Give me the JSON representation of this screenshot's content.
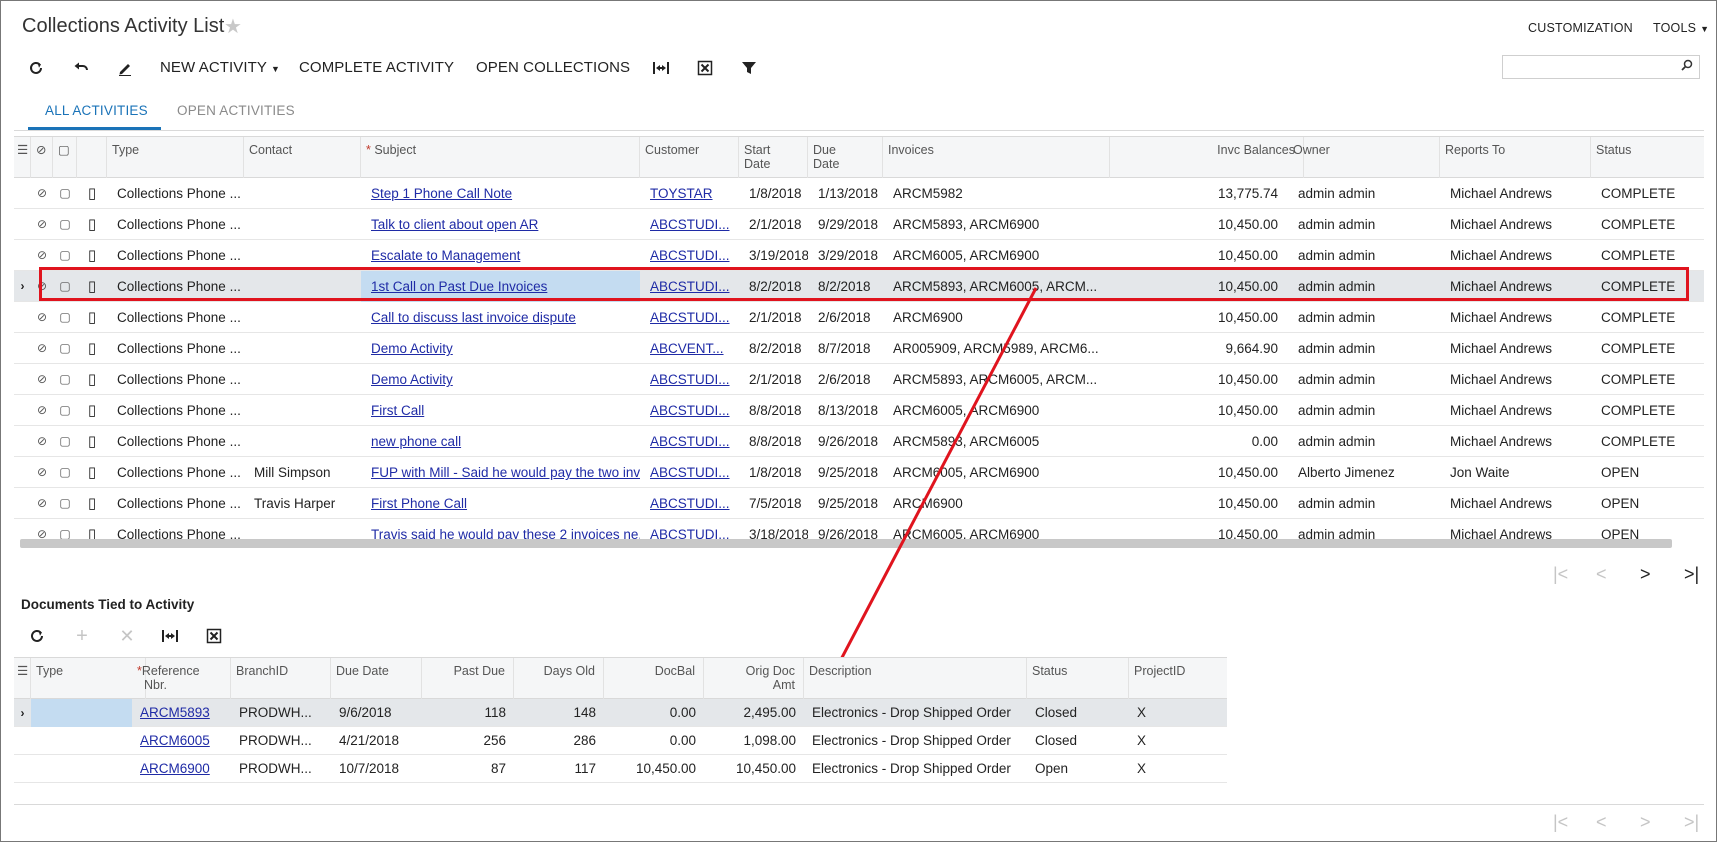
{
  "header": {
    "title": "Collections Activity List",
    "customization": "CUSTOMIZATION",
    "tools": "TOOLS"
  },
  "toolbar": {
    "new_activity": "NEW ACTIVITY",
    "complete_activity": "COMPLETE ACTIVITY",
    "open_collections": "OPEN COLLECTIONS",
    "search_value": ""
  },
  "tabs": [
    {
      "label": "ALL ACTIVITIES"
    },
    {
      "label": "OPEN ACTIVITIES"
    }
  ],
  "grid": {
    "columns": {
      "type": "Type",
      "contact": "Contact",
      "subject": "Subject",
      "customer": "Customer",
      "start_date_1": "Start",
      "start_date_2": "Date",
      "due_date_1": "Due",
      "due_date_2": "Date",
      "invoices": "Invoices",
      "invc_balances": "Invc Balances",
      "owner": "Owner",
      "reports_to": "Reports To",
      "status": "Status"
    },
    "rows": [
      {
        "type": "Collections Phone ...",
        "contact": "",
        "subject": "Step 1 Phone Call Note",
        "customer": "TOYSTAR",
        "start": "1/8/2018",
        "due": "1/13/2018",
        "invoices": "ARCM5982",
        "balance": "13,775.74",
        "owner": "admin admin",
        "reports_to": "Michael Andrews",
        "status": "COMPLETE"
      },
      {
        "type": "Collections Phone ...",
        "contact": "",
        "subject": "Talk to client about open AR",
        "customer": "ABCSTUDI...",
        "start": "2/1/2018",
        "due": "9/29/2018",
        "invoices": "ARCM5893, ARCM6900",
        "balance": "10,450.00",
        "owner": "admin admin",
        "reports_to": "Michael Andrews",
        "status": "COMPLETE"
      },
      {
        "type": "Collections Phone ...",
        "contact": "",
        "subject": "Escalate to Management",
        "customer": "ABCSTUDI...",
        "start": "3/19/2018",
        "due": "3/29/2018",
        "invoices": "ARCM6005, ARCM6900",
        "balance": "10,450.00",
        "owner": "admin admin",
        "reports_to": "Michael Andrews",
        "status": "COMPLETE"
      },
      {
        "type": "Collections Phone ...",
        "contact": "",
        "subject": "1st Call on Past Due Invoices",
        "customer": "ABCSTUDI...",
        "start": "8/2/2018",
        "due": "8/2/2018",
        "invoices": "ARCM5893, ARCM6005, ARCM...",
        "balance": "10,450.00",
        "owner": "admin admin",
        "reports_to": "Michael Andrews",
        "status": "COMPLETE"
      },
      {
        "type": "Collections Phone ...",
        "contact": "",
        "subject": "Call to discuss last invoice dispute",
        "customer": "ABCSTUDI...",
        "start": "2/1/2018",
        "due": "2/6/2018",
        "invoices": "ARCM6900",
        "balance": "10,450.00",
        "owner": "admin admin",
        "reports_to": "Michael Andrews",
        "status": "COMPLETE"
      },
      {
        "type": "Collections Phone ...",
        "contact": "",
        "subject": "Demo Activity",
        "customer": "ABCVENT...",
        "start": "8/2/2018",
        "due": "8/7/2018",
        "invoices": "AR005909, ARCM5989, ARCM6...",
        "balance": "9,664.90",
        "owner": "admin admin",
        "reports_to": "Michael Andrews",
        "status": "COMPLETE"
      },
      {
        "type": "Collections Phone ...",
        "contact": "",
        "subject": "Demo Activity",
        "customer": "ABCSTUDI...",
        "start": "2/1/2018",
        "due": "2/6/2018",
        "invoices": "ARCM5893, ARCM6005, ARCM...",
        "balance": "10,450.00",
        "owner": "admin admin",
        "reports_to": "Michael Andrews",
        "status": "COMPLETE"
      },
      {
        "type": "Collections Phone ...",
        "contact": "",
        "subject": "First Call",
        "customer": "ABCSTUDI...",
        "start": "8/8/2018",
        "due": "8/13/2018",
        "invoices": "ARCM6005, ARCM6900",
        "balance": "10,450.00",
        "owner": "admin admin",
        "reports_to": "Michael Andrews",
        "status": "COMPLETE"
      },
      {
        "type": "Collections Phone ...",
        "contact": "",
        "subject": "new phone call",
        "customer": "ABCSTUDI...",
        "start": "8/8/2018",
        "due": "9/26/2018",
        "invoices": "ARCM5893, ARCM6005",
        "balance": "0.00",
        "owner": "admin admin",
        "reports_to": "Michael Andrews",
        "status": "COMPLETE"
      },
      {
        "type": "Collections Phone ...",
        "contact": "Mill Simpson",
        "subject": "FUP with Mill - Said he would pay the two inv...",
        "customer": "ABCSTUDI...",
        "start": "1/8/2018",
        "due": "9/25/2018",
        "invoices": "ARCM6005, ARCM6900",
        "balance": "10,450.00",
        "owner": "Alberto Jimenez",
        "reports_to": "Jon Waite",
        "status": "OPEN"
      },
      {
        "type": "Collections Phone ...",
        "contact": "Travis Harper",
        "subject": "First Phone Call",
        "customer": "ABCSTUDI...",
        "start": "7/5/2018",
        "due": "9/25/2018",
        "invoices": "ARCM6900",
        "balance": "10,450.00",
        "owner": "admin admin",
        "reports_to": "Michael Andrews",
        "status": "OPEN"
      },
      {
        "type": "Collections Phone ...",
        "contact": "",
        "subject": "Travis said he would pay these 2 invoices ne...",
        "customer": "ABCSTUDI...",
        "start": "3/18/2018",
        "due": "9/26/2018",
        "invoices": "ARCM6005, ARCM6900",
        "balance": "10,450.00",
        "owner": "admin admin",
        "reports_to": "Michael Andrews",
        "status": "OPEN"
      }
    ]
  },
  "documents": {
    "title": "Documents Tied to Activity",
    "columns": {
      "type": "Type",
      "ref_1": "Reference",
      "ref_2": "Nbr.",
      "branch": "BranchID",
      "due_date": "Due Date",
      "past_due": "Past Due",
      "days_old": "Days Old",
      "docbal": "DocBal",
      "orig_1": "Orig Doc",
      "orig_2": "Amt",
      "description": "Description",
      "status": "Status",
      "project": "ProjectID"
    },
    "rows": [
      {
        "type": "",
        "ref": "ARCM5893",
        "branch": "PRODWH...",
        "due_date": "9/6/2018",
        "past_due": "118",
        "days_old": "148",
        "docbal": "0.00",
        "orig": "2,495.00",
        "description": "Electronics - Drop Shipped Order",
        "status": "Closed",
        "project": "X"
      },
      {
        "type": "",
        "ref": "ARCM6005",
        "branch": "PRODWH...",
        "due_date": "4/21/2018",
        "past_due": "256",
        "days_old": "286",
        "docbal": "0.00",
        "orig": "1,098.00",
        "description": "Electronics - Drop Shipped Order",
        "status": "Closed",
        "project": "X"
      },
      {
        "type": "",
        "ref": "ARCM6900",
        "branch": "PRODWH...",
        "due_date": "10/7/2018",
        "past_due": "87",
        "days_old": "117",
        "docbal": "10,450.00",
        "orig": "10,450.00",
        "description": "Electronics - Drop Shipped Order",
        "status": "Open",
        "project": "X"
      }
    ]
  },
  "colors": {
    "accent": "#1a73b8",
    "link": "#1f2ba6",
    "highlight_box": "#e0141e",
    "selected_row": "#e4e7ea",
    "selected_cell": "#c4dcf1"
  }
}
